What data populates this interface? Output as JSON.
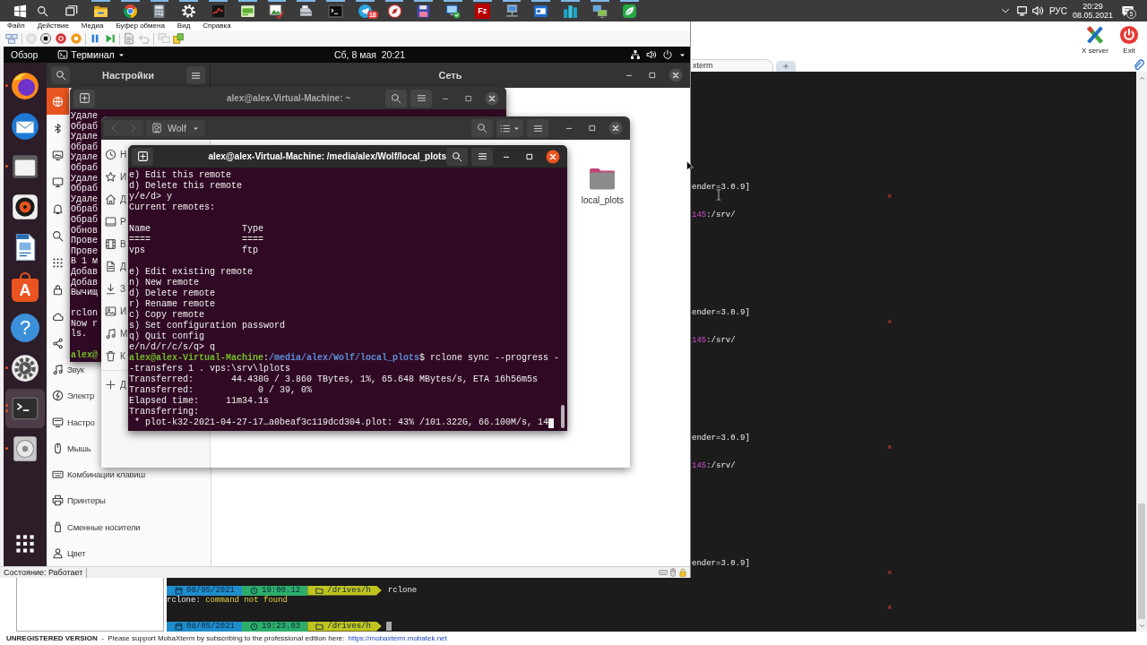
{
  "taskbar": {
    "system": [
      {
        "kind": "start"
      },
      {
        "kind": "search"
      },
      {
        "kind": "task-view"
      }
    ],
    "apps": [
      {
        "kind": "explorer",
        "running": true
      },
      {
        "kind": "chrome",
        "running": true
      },
      {
        "kind": "calculator",
        "running": true
      },
      {
        "kind": "gear",
        "running": true
      },
      {
        "kind": "graph",
        "running": true
      },
      {
        "kind": "green-panel",
        "running": true
      },
      {
        "kind": "picture",
        "running": true
      },
      {
        "kind": "scanner",
        "running": true
      },
      {
        "kind": "console",
        "running": true
      },
      {
        "kind": "telegram",
        "running": true,
        "badge": "18"
      },
      {
        "kind": "compass",
        "running": true
      },
      {
        "kind": "floppy",
        "running": true
      },
      {
        "kind": "computer-check",
        "running": true
      },
      {
        "kind": "logo",
        "running": true,
        "logo": "Fz"
      },
      {
        "kind": "network-pc",
        "running": true
      },
      {
        "kind": "blue-window",
        "running": true
      },
      {
        "kind": "blocks",
        "running": true
      },
      {
        "kind": "monitors",
        "running": true
      },
      {
        "kind": "leaf",
        "running": true
      }
    ],
    "tray": {
      "language": "РУС",
      "time": "20:29",
      "date": "08.05.2021",
      "notifications": "5"
    }
  },
  "vm_window": {
    "menu": [
      "Файл",
      "Действие",
      "Медиа",
      "Буфер обмена",
      "Вид",
      "Справка"
    ],
    "toolbar": [
      {
        "kind": "ctrl-alt-del",
        "disabled": false
      },
      {
        "kind": "start",
        "disabled": true
      },
      {
        "kind": "turn-off",
        "disabled": false
      },
      {
        "kind": "shut-down",
        "disabled": false
      },
      {
        "kind": "save",
        "disabled": false
      },
      {
        "kind": "pause",
        "disabled": false
      },
      {
        "kind": "reset",
        "disabled": false
      },
      {
        "kind": "checkpoint",
        "disabled": false
      },
      {
        "kind": "revert",
        "disabled": true
      },
      {
        "kind": "enhanced-session",
        "disabled": true
      },
      {
        "kind": "share",
        "disabled": false
      }
    ],
    "guest": {
      "top_bar": {
        "activities": "Обзор",
        "app": "Терминал",
        "clock": "Сб, 8 мая  20:21"
      },
      "dock": [
        {
          "kind": "firefox",
          "running": true,
          "focused": false,
          "multiple_windows": false
        },
        {
          "kind": "thunderbird",
          "running": false,
          "focused": false,
          "multiple_windows": false
        },
        {
          "kind": "files",
          "running": true,
          "focused": false,
          "multiple_windows": false
        },
        {
          "kind": "rhythmbox",
          "running": false,
          "focused": false,
          "multiple_windows": false
        },
        {
          "kind": "writer",
          "running": false,
          "focused": false,
          "multiple_windows": false
        },
        {
          "kind": "software",
          "glyph": "A",
          "running": false,
          "focused": false,
          "multiple_windows": false
        },
        {
          "kind": "help",
          "glyph": "?",
          "running": false,
          "focused": false,
          "multiple_windows": false
        },
        {
          "kind": "settings",
          "running": true,
          "focused": false,
          "multiple_windows": false
        },
        {
          "kind": "terminal",
          "running": true,
          "focused": true,
          "multiple_windows": true
        },
        {
          "kind": "disc",
          "running": true,
          "focused": false,
          "multiple_windows": false
        }
      ],
      "settings": {
        "title": "Настройки",
        "page_title": "Сеть",
        "focused": false,
        "sidebar": [
          {
            "kind": "network",
            "selected": true
          },
          {
            "kind": "bluetooth",
            "selected": false
          },
          {
            "kind": "background",
            "selected": false
          },
          {
            "kind": "appearance",
            "selected": false
          },
          {
            "kind": "notifications",
            "selected": false
          },
          {
            "kind": "search",
            "selected": false
          },
          {
            "kind": "applications",
            "selected": false
          },
          {
            "kind": "privacy",
            "selected": false
          },
          {
            "kind": "online-accounts",
            "selected": false
          },
          {
            "kind": "sharing",
            "selected": false
          },
          {
            "kind": "sound",
            "label": "Звук",
            "selected": false
          },
          {
            "kind": "power",
            "label": "Электр",
            "selected": false
          },
          {
            "kind": "displays",
            "label": "Настро",
            "selected": false
          },
          {
            "kind": "mouse",
            "label": "Мышь",
            "selected": false
          },
          {
            "kind": "keyboard",
            "label": "Комбинации клавиш",
            "selected": false
          },
          {
            "kind": "printers",
            "label": "Принтеры",
            "selected": false
          },
          {
            "kind": "removable-media",
            "label": "Сменные носители",
            "selected": false
          },
          {
            "kind": "color",
            "label": "Цвет",
            "selected": false
          }
        ]
      },
      "windows": [
        {
          "kind": "terminal",
          "title": "alex@alex-Virtual-Machine: ~",
          "focused": false,
          "cursor": false,
          "blocks": [
            [
              "Удале",
              "Обраб",
              "Удале",
              "Обраб",
              "Удале",
              "Обраб",
              "Удале",
              "Обраб",
              "Удале",
              "Обраб",
              "Обраб",
              "Обнов",
              "Прове",
              "Прове",
              "В 1 м",
              "Добав",
              "Добав",
              "Вычищ"
            ],
            [
              "rclon",
              "Now r",
              "ls."
            ],
            [
              {
                "kind": "prompt",
                "user": "alex@"
              }
            ]
          ]
        },
        {
          "kind": "files",
          "location": "Wolf",
          "focused": false,
          "places": [
            {
              "kind": "recent",
              "label": "Н"
            },
            {
              "kind": "starred",
              "label": "И"
            },
            {
              "kind": "home",
              "label": "Д"
            },
            {
              "kind": "desktop",
              "label": "Р"
            },
            {
              "kind": "videos",
              "label": "В"
            },
            {
              "kind": "documents",
              "label": "Д"
            },
            {
              "kind": "downloads",
              "label": "З"
            },
            {
              "kind": "pictures",
              "label": "И"
            },
            {
              "kind": "music",
              "label": "М"
            },
            {
              "kind": "trash",
              "label": "К"
            },
            {
              "kind": "other",
              "label": "Д"
            }
          ],
          "items": [
            {
              "kind": "folder",
              "label": "local_plots"
            }
          ]
        },
        {
          "kind": "terminal",
          "title": "alex@alex-Virtual-Machine: /media/alex/Wolf/local_plots",
          "focused": true,
          "cursor": true,
          "blocks": [
            [
              "e) Edit this remote",
              "d) Delete this remote",
              "y/e/d> y",
              "Current remotes:"
            ],
            [
              "Name                 Type",
              "====                 ====",
              "vps                  ftp"
            ],
            [
              "e) Edit existing remote",
              "n) New remote",
              "d) Delete remote",
              "r) Rename remote",
              "c) Copy remote",
              "s) Set configuration password",
              "q) Quit config",
              "e/n/d/r/c/s/q> q",
              {
                "kind": "prompt",
                "user": "alex@alex-Virtual-Machine",
                "separator": ":",
                "path": "/media/alex/Wolf/local_plots",
                "command": "$ rclone sync --progress -"
              },
              "-transfers 1 . vps:\\srv\\lplots",
              "Transferred:       44.438G / 3.860 TBytes, 1%, 65.648 MBytes/s, ETA 16h56m5s",
              "Transferred:            0 / 39, 0%",
              "Elapsed time:     11m34.1s",
              "Transferring:",
              " * plot-k32-2021-04-27-17…a0beaf3c119dcd304.plot: 43% /101.322G, 66.100M/s, 14"
            ]
          ]
        }
      ]
    },
    "status": "Состояние: Работает"
  },
  "mobaxterm": {
    "toolbar": [
      {
        "kind": "x-server",
        "label": "X server"
      },
      {
        "kind": "exit",
        "label": "Exit"
      }
    ],
    "tabs": [
      {
        "label": "xterm",
        "selected": true
      }
    ],
    "right_blocks": [
      [
        {
          "kind": "output",
          "text": "ender=3.0.9]"
        },
        {
          "kind": "mark",
          "text": "×"
        },
        {
          "kind": "path",
          "host": "145",
          "path": ":/srv/"
        }
      ],
      [
        {
          "kind": "output",
          "text": "ender=3.0.9]"
        },
        {
          "kind": "mark",
          "text": "×"
        },
        {
          "kind": "path",
          "host": "145",
          "path": ":/srv/"
        }
      ],
      [
        {
          "kind": "output",
          "text": "ender=3.0.9]"
        },
        {
          "kind": "mark",
          "text": "×"
        },
        {
          "kind": "path",
          "host": "145",
          "path": ":/srv/"
        }
      ],
      [
        {
          "kind": "output",
          "text": "ender=3.0.9]"
        },
        {
          "kind": "mark",
          "text": "×"
        },
        {
          "kind": "mark",
          "text": "×"
        }
      ]
    ],
    "session": [
      {
        "kind": "prompt",
        "date": "08/05/2021",
        "time": "19:00.12",
        "dir": "/drives/h",
        "command": "rclone"
      },
      {
        "kind": "error",
        "program": "rclone:",
        "message": "command not found"
      },
      {
        "kind": "prompt",
        "date": "08/05/2021",
        "time": "19:23.03",
        "dir": "/drives/h"
      }
    ],
    "cursor": true,
    "footer": {
      "notice": "**UNREGISTERED VERSION**  -  Please support MobaXterm by subscribing to the professional edition here:",
      "link": "https://mobaxterm.mobatek.net"
    }
  }
}
